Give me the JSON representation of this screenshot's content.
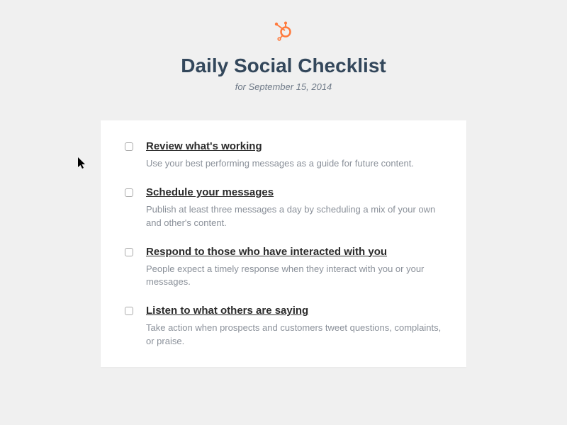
{
  "header": {
    "title": "Daily Social Checklist",
    "date": "for September 15, 2014"
  },
  "items": [
    {
      "title": "Review what's working",
      "desc": "Use your best performing messages as a guide for future content."
    },
    {
      "title": "Schedule your messages",
      "desc": "Publish at least three messages a day by scheduling a mix of your own and other's content."
    },
    {
      "title": "Respond to those who have interacted with you",
      "desc": "People expect a timely response when they interact with you or your messages."
    },
    {
      "title": "Listen to what others are saying",
      "desc": "Take action when prospects and customers tweet questions, complaints, or praise."
    }
  ],
  "colors": {
    "accent": "#ff7a3c"
  }
}
